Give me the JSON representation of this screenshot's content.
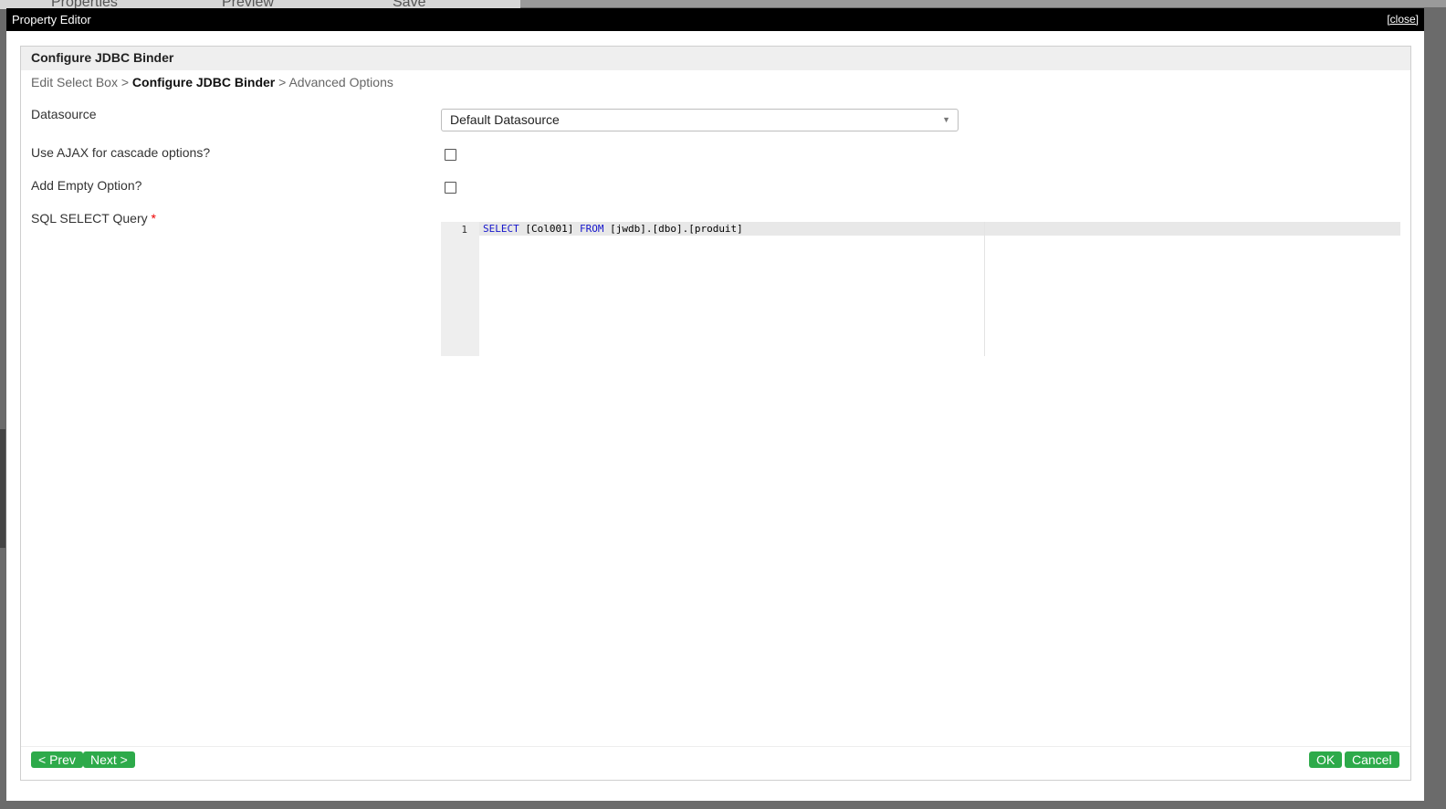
{
  "background": {
    "toolbar_items": [
      "Properties",
      "Preview",
      "Save"
    ]
  },
  "window": {
    "title": "Property Editor",
    "close_label": "[close]"
  },
  "panel": {
    "title": "Configure JDBC Binder",
    "breadcrumb": {
      "step1": "Edit Select Box",
      "sep": ">",
      "step2": "Configure JDBC Binder",
      "step3": "Advanced Options"
    }
  },
  "form": {
    "datasource_label": "Datasource",
    "datasource_value": "Default Datasource",
    "ajax_label": "Use AJAX for cascade options?",
    "ajax_checked": false,
    "empty_label": "Add Empty Option?",
    "empty_checked": false,
    "sql_label": "SQL SELECT Query",
    "required_mark": "*",
    "sql": {
      "line_number": "1",
      "kw_select": "SELECT",
      "part1": " [Col001] ",
      "kw_from": "FROM",
      "part2": " [jwdb].[dbo].[produit]"
    }
  },
  "buttons": {
    "prev": "< Prev",
    "next": "Next >",
    "ok": "OK",
    "cancel": "Cancel"
  },
  "colors": {
    "button_green": "#2daa4a",
    "titlebar": "#000000",
    "sql_keyword": "#1515cc",
    "required": "#ee0000"
  }
}
